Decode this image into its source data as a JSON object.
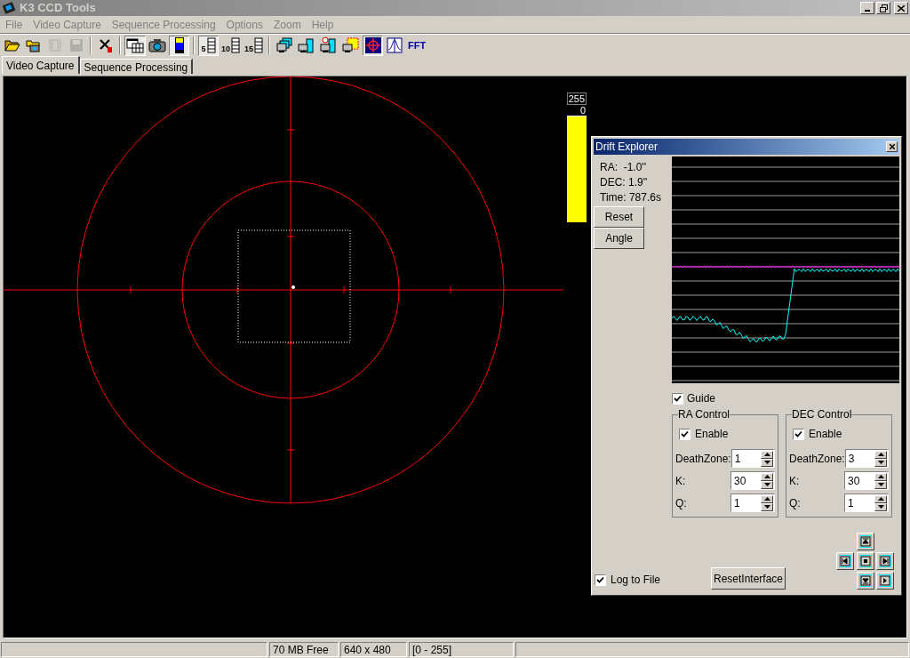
{
  "window": {
    "title": "K3 CCD Tools"
  },
  "menu": [
    {
      "label": "File"
    },
    {
      "label": "Video Capture"
    },
    {
      "label": "Sequence Processing"
    },
    {
      "label": "Options"
    },
    {
      "label": "Zoom"
    },
    {
      "label": "Help"
    }
  ],
  "toolbar": [
    {
      "kind": "folder-open",
      "pressed": false,
      "disabled": false
    },
    {
      "kind": "folder-camera",
      "pressed": false,
      "disabled": false
    },
    {
      "kind": "film-stack",
      "pressed": false,
      "disabled": true
    },
    {
      "kind": "save",
      "pressed": false,
      "disabled": true
    },
    {
      "kind": "separator"
    },
    {
      "kind": "tools",
      "pressed": false,
      "disabled": false
    },
    {
      "kind": "separator"
    },
    {
      "kind": "windows",
      "pressed": true,
      "disabled": false
    },
    {
      "kind": "camera",
      "pressed": false,
      "disabled": false
    },
    {
      "kind": "level",
      "pressed": true,
      "disabled": false
    },
    {
      "kind": "separator"
    },
    {
      "kind": "frames",
      "label": "5",
      "pressed": true,
      "disabled": false
    },
    {
      "kind": "frames",
      "label": "10",
      "pressed": false,
      "disabled": false
    },
    {
      "kind": "frames",
      "label": "15",
      "pressed": false,
      "disabled": false
    },
    {
      "kind": "separator"
    },
    {
      "kind": "monitors",
      "pressed": false,
      "disabled": false
    },
    {
      "kind": "monitor-film",
      "pressed": false,
      "disabled": false
    },
    {
      "kind": "monitor-timer",
      "pressed": false,
      "disabled": false
    },
    {
      "kind": "monitor-select",
      "pressed": false,
      "disabled": false
    },
    {
      "kind": "crosshair",
      "pressed": true,
      "disabled": false
    },
    {
      "kind": "profile",
      "pressed": false,
      "disabled": false
    },
    {
      "kind": "text",
      "label": "FFT",
      "pressed": false,
      "disabled": false
    }
  ],
  "tabs": [
    {
      "label": "Video Capture",
      "selected": true
    },
    {
      "label": "Sequence Processing",
      "selected": false
    }
  ],
  "histogram": {
    "max": "255",
    "min": "0",
    "level": 1
  },
  "drift_explorer": {
    "title": "Drift Explorer",
    "readouts": [
      "RA:  -1.0''",
      "DEC: 1.9''",
      "Time: 787.6s"
    ],
    "buttons": [
      "Reset",
      "Angle"
    ],
    "guide": {
      "label": "Guide",
      "checked": true
    },
    "controls": [
      {
        "title": "RA Control",
        "enable": {
          "label": "Enable",
          "checked": true
        },
        "fields": [
          {
            "label": "DeathZone:",
            "value": "1"
          },
          {
            "label": "K:",
            "value": "30"
          },
          {
            "label": "Q:",
            "value": "1"
          }
        ]
      },
      {
        "title": "DEC Control",
        "enable": {
          "label": "Enable",
          "checked": true
        },
        "fields": [
          {
            "label": "DeathZone:",
            "value": "3"
          },
          {
            "label": "K:",
            "value": "30"
          },
          {
            "label": "Q:",
            "value": "1"
          }
        ]
      }
    ],
    "log_to_file": {
      "label": "Log to File",
      "checked": true
    },
    "reset_interface": "ResetInterface"
  },
  "status_bar": [
    {
      "text": "70 MB Free"
    },
    {
      "text": "640 x 480"
    },
    {
      "text": "[0 - 255]"
    }
  ]
}
